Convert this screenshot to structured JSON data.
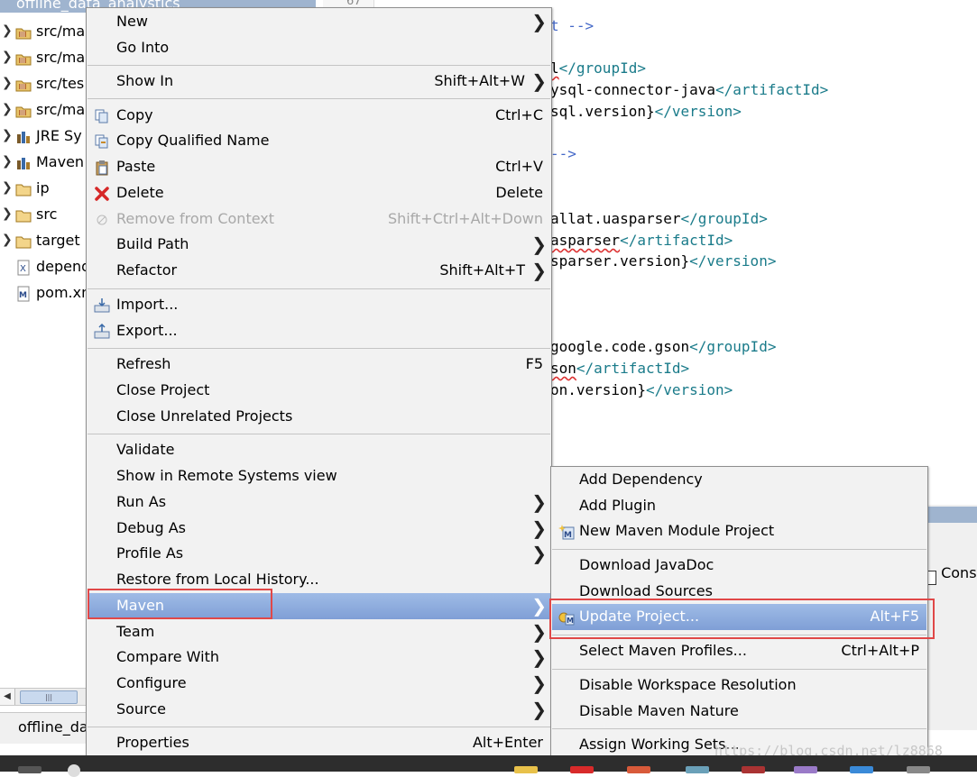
{
  "explorer": {
    "project_title": "offline_data_analystics",
    "items": [
      {
        "label": "src/ma",
        "icon": "source-folder-icon"
      },
      {
        "label": "src/ma",
        "icon": "source-folder-icon"
      },
      {
        "label": "src/tes",
        "icon": "source-folder-icon"
      },
      {
        "label": "src/ma",
        "icon": "source-folder-icon"
      },
      {
        "label": "JRE Sy",
        "icon": "library-icon"
      },
      {
        "label": "Maven",
        "icon": "library-icon"
      },
      {
        "label": "ip",
        "icon": "folder-icon"
      },
      {
        "label": "src",
        "icon": "folder-icon"
      },
      {
        "label": "target",
        "icon": "folder-icon"
      },
      {
        "label": "depend",
        "icon": "xml-file-icon"
      },
      {
        "label": "pom.xm",
        "icon": "maven-file-icon"
      }
    ],
    "bottom_tab": "offline_da"
  },
  "editor": {
    "line_number": "67",
    "lines": [
      {
        "parts": [
          {
            "t": "t -->",
            "c": "comment"
          }
        ]
      },
      {
        "parts": [
          {
            "t": "l",
            "c": "plain-squig"
          },
          {
            "t": "</groupId>",
            "c": "tag"
          }
        ]
      },
      {
        "parts": [
          {
            "t": "ysql-connector-java",
            "c": "plain"
          },
          {
            "t": "</artifactId>",
            "c": "tag"
          }
        ]
      },
      {
        "parts": [
          {
            "t": "sql.version}",
            "c": "plain"
          },
          {
            "t": "</version>",
            "c": "tag"
          }
        ]
      },
      {
        "parts": [
          {
            "t": "-->",
            "c": "comment"
          }
        ]
      },
      {
        "parts": [
          {
            "t": "allat.uasparser",
            "c": "plain"
          },
          {
            "t": "</groupId>",
            "c": "tag"
          }
        ]
      },
      {
        "parts": [
          {
            "t": "asparser",
            "c": "plain-squig"
          },
          {
            "t": "</artifactId>",
            "c": "tag"
          }
        ]
      },
      {
        "parts": [
          {
            "t": "sparser.version}",
            "c": "plain"
          },
          {
            "t": "</version>",
            "c": "tag"
          }
        ]
      },
      {
        "parts": [
          {
            "t": "google.code.gson",
            "c": "plain"
          },
          {
            "t": "</groupId>",
            "c": "tag"
          }
        ]
      },
      {
        "parts": [
          {
            "t": "son",
            "c": "plain-squig"
          },
          {
            "t": "</artifactId>",
            "c": "tag"
          }
        ]
      },
      {
        "parts": [
          {
            "t": "on.version}",
            "c": "plain"
          },
          {
            "t": "</version>",
            "c": "tag"
          }
        ]
      }
    ],
    "console_label": "Conso"
  },
  "context_menu": {
    "items": [
      {
        "label": "New",
        "shortcut": "",
        "submenu": true
      },
      {
        "label": "Go Into",
        "shortcut": ""
      },
      {
        "label": "Show In",
        "shortcut": "Shift+Alt+W",
        "submenu": true
      },
      {
        "label": "Copy",
        "shortcut": "Ctrl+C",
        "icon": "copy-icon"
      },
      {
        "label": "Copy Qualified Name",
        "shortcut": "",
        "icon": "copy-qualified-name-icon"
      },
      {
        "label": "Paste",
        "shortcut": "Ctrl+V",
        "icon": "paste-icon"
      },
      {
        "label": "Delete",
        "shortcut": "Delete",
        "icon": "delete-icon"
      },
      {
        "label": "Remove from Context",
        "shortcut": "Shift+Ctrl+Alt+Down",
        "icon": "remove-context-icon",
        "disabled": true
      },
      {
        "label": "Build Path",
        "shortcut": "",
        "submenu": true
      },
      {
        "label": "Refactor",
        "shortcut": "Shift+Alt+T",
        "submenu": true
      },
      {
        "label": "Import...",
        "shortcut": "",
        "icon": "import-icon"
      },
      {
        "label": "Export...",
        "shortcut": "",
        "icon": "export-icon"
      },
      {
        "label": "Refresh",
        "shortcut": "F5"
      },
      {
        "label": "Close Project",
        "shortcut": ""
      },
      {
        "label": "Close Unrelated Projects",
        "shortcut": ""
      },
      {
        "label": "Validate",
        "shortcut": ""
      },
      {
        "label": "Show in Remote Systems view",
        "shortcut": ""
      },
      {
        "label": "Run As",
        "shortcut": "",
        "submenu": true
      },
      {
        "label": "Debug As",
        "shortcut": "",
        "submenu": true
      },
      {
        "label": "Profile As",
        "shortcut": "",
        "submenu": true
      },
      {
        "label": "Restore from Local History...",
        "shortcut": ""
      },
      {
        "label": "Maven",
        "shortcut": "",
        "submenu": true,
        "highlight": true
      },
      {
        "label": "Team",
        "shortcut": "",
        "submenu": true
      },
      {
        "label": "Compare With",
        "shortcut": "",
        "submenu": true
      },
      {
        "label": "Configure",
        "shortcut": "",
        "submenu": true
      },
      {
        "label": "Source",
        "shortcut": "",
        "submenu": true
      },
      {
        "label": "Properties",
        "shortcut": "Alt+Enter"
      }
    ]
  },
  "maven_submenu": {
    "items": [
      {
        "label": "Add Dependency",
        "shortcut": ""
      },
      {
        "label": "Add Plugin",
        "shortcut": ""
      },
      {
        "label": "New Maven Module Project",
        "shortcut": "",
        "icon": "maven-module-icon"
      },
      {
        "label": "Download JavaDoc",
        "shortcut": ""
      },
      {
        "label": "Download Sources",
        "shortcut": ""
      },
      {
        "label": "Update Project...",
        "shortcut": "Alt+F5",
        "icon": "update-project-icon",
        "highlight": true
      },
      {
        "label": "Select Maven Profiles...",
        "shortcut": "Ctrl+Alt+P"
      },
      {
        "label": "Disable Workspace Resolution",
        "shortcut": ""
      },
      {
        "label": "Disable Maven Nature",
        "shortcut": ""
      },
      {
        "label": "Assign Working Sets...",
        "shortcut": ""
      }
    ]
  },
  "watermark": "https://blog.csdn.net/lz8868",
  "colors": {
    "highlight": "#8aa9dd",
    "annotation_box": "#e04848",
    "xml_tag": "#1a7b8a",
    "comment": "#4468c8"
  }
}
